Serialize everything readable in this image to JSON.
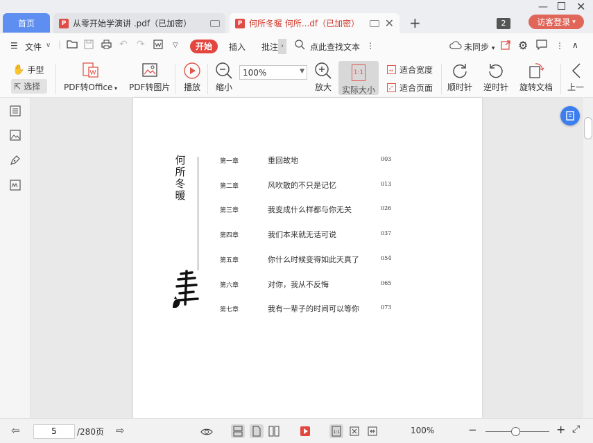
{
  "tabs": {
    "home": "首页",
    "doc1": "从零开始学演讲 .pdf（已加密）",
    "doc2": "何所冬暖 何所...df（已加密）",
    "window_count": "2",
    "login": "访客登录"
  },
  "menu": {
    "file": "文件",
    "start": "开始",
    "insert": "插入",
    "annotate": "批注",
    "search": "点此查找文本",
    "sync": "未同步"
  },
  "ribbon": {
    "hand": "手型",
    "select": "选择",
    "pdf_to_office": "PDF转Office",
    "pdf_to_image": "PDF转图片",
    "play": "播放",
    "zoom_out": "缩小",
    "zoom_value": "100%",
    "zoom_in": "放大",
    "actual_size": "实际大小",
    "fit_width": "适合宽度",
    "fit_page": "适合页面",
    "rotate_cw": "顺时针",
    "rotate_ccw": "逆时针",
    "rotate_doc": "旋转文档",
    "prev": "上一"
  },
  "page": {
    "vertical_title": "何所冬暖",
    "toc": [
      {
        "chapter": "第一章",
        "title": "重回故地",
        "page": "003"
      },
      {
        "chapter": "第二章",
        "title": "风吹散的不只是记忆",
        "page": "013"
      },
      {
        "chapter": "第三章",
        "title": "我变成什么样都与你无关",
        "page": "026"
      },
      {
        "chapter": "第四章",
        "title": "我们本来就无话可说",
        "page": "037"
      },
      {
        "chapter": "第五章",
        "title": "你什么时候变得如此天真了",
        "page": "054"
      },
      {
        "chapter": "第六章",
        "title": "对你，我从不反悔",
        "page": "065"
      },
      {
        "chapter": "第七章",
        "title": "我有一辈子的时间可以等你",
        "page": "073"
      }
    ]
  },
  "status": {
    "current_page": "5",
    "total_pages": "/280页",
    "zoom": "100%"
  },
  "colors": {
    "accent_blue": "#5e8ef0",
    "accent_red": "#e2463f"
  }
}
